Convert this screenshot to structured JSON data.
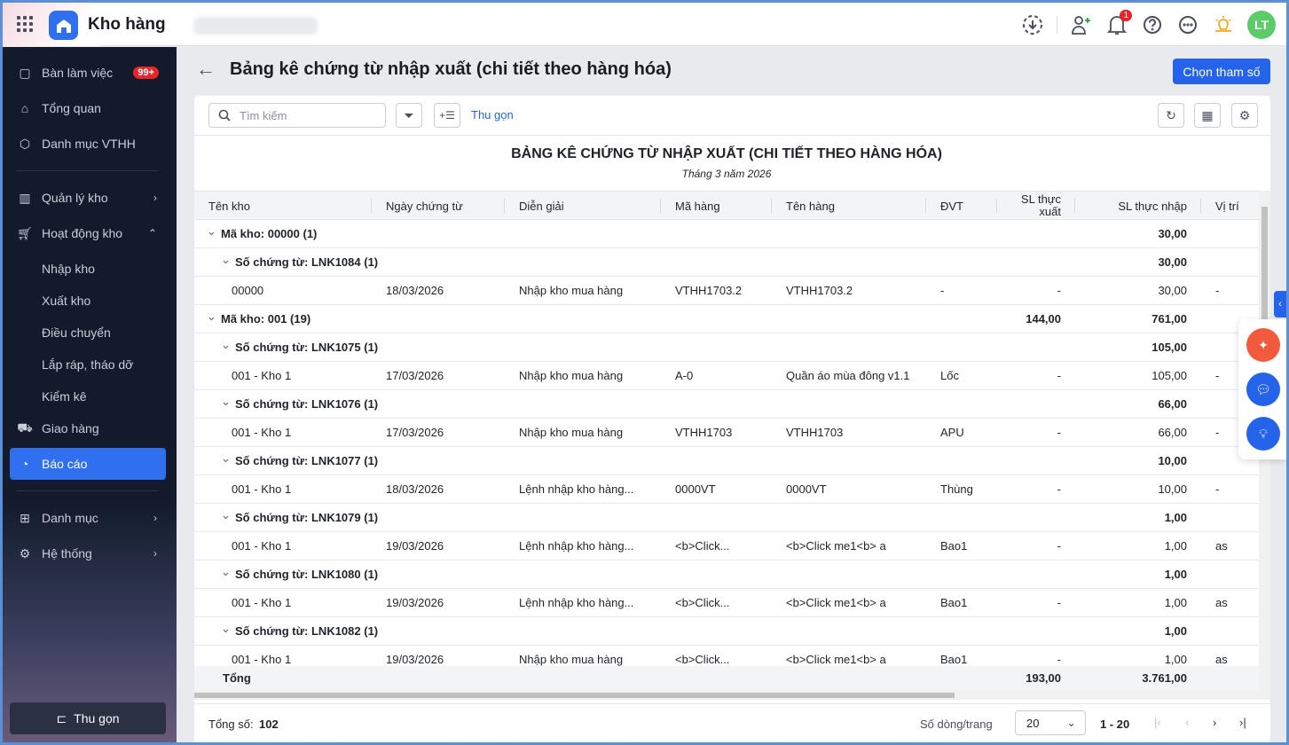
{
  "app": {
    "title": "Kho hàng",
    "notification_count": "1",
    "avatar_initials": "LT"
  },
  "sidebar": {
    "items": [
      {
        "label": "Bàn làm việc",
        "badge": "99+"
      },
      {
        "label": "Tổng quan"
      },
      {
        "label": "Danh mục VTHH"
      },
      {
        "label": "Quản lý kho"
      },
      {
        "label": "Hoạt động kho"
      },
      {
        "label": "Nhập kho"
      },
      {
        "label": "Xuất kho"
      },
      {
        "label": "Điều chuyển"
      },
      {
        "label": "Lắp ráp, tháo dỡ"
      },
      {
        "label": "Kiểm kê"
      },
      {
        "label": "Giao hàng"
      },
      {
        "label": "Báo cáo"
      },
      {
        "label": "Danh mục"
      },
      {
        "label": "Hệ thống"
      }
    ],
    "collapse_label": "Thu gọn"
  },
  "page": {
    "title": "Bảng kê chứng từ nhập xuất (chi tiết theo hàng hóa)",
    "choose_params": "Chọn tham số"
  },
  "toolbar": {
    "search_placeholder": "Tìm kiếm",
    "collapse_link": "Thu gọn"
  },
  "report": {
    "title": "BẢNG KÊ CHỨNG TỪ NHẬP XUẤT (CHI TIẾT THEO HÀNG HÓA)",
    "subtitle": "Tháng 3 năm 2026"
  },
  "table": {
    "columns": [
      "Tên kho",
      "Ngày chứng từ",
      "Diễn giải",
      "Mã hàng",
      "Tên hàng",
      "ĐVT",
      "SL thực xuất",
      "SL thực nhập",
      "Vị trí"
    ],
    "rows": [
      {
        "type": "g1",
        "label": "Mã kho: 00000 (1)",
        "xuat": "",
        "nhap": "30,00"
      },
      {
        "type": "g2",
        "label": "Số chứng từ: LNK1084 (1)",
        "xuat": "",
        "nhap": "30,00"
      },
      {
        "type": "d",
        "cells": [
          "00000",
          "18/03/2026",
          "Nhập kho mua hàng",
          "VTHH1703.2",
          "VTHH1703.2",
          "-",
          "-",
          "30,00",
          "-"
        ]
      },
      {
        "type": "g1",
        "label": "Mã kho: 001 (19)",
        "xuat": "144,00",
        "nhap": "761,00"
      },
      {
        "type": "g2",
        "label": "Số chứng từ: LNK1075 (1)",
        "xuat": "",
        "nhap": "105,00"
      },
      {
        "type": "d",
        "cells": [
          "001 - Kho 1",
          "17/03/2026",
          "Nhập kho mua hàng",
          "A-0",
          "Quần áo mùa đông v1.1",
          "Lốc",
          "-",
          "105,00",
          "-"
        ]
      },
      {
        "type": "g2",
        "label": "Số chứng từ: LNK1076 (1)",
        "xuat": "",
        "nhap": "66,00"
      },
      {
        "type": "d",
        "cells": [
          "001 - Kho 1",
          "17/03/2026",
          "Nhập kho mua hàng",
          "VTHH1703",
          "VTHH1703",
          "APU",
          "-",
          "66,00",
          "-"
        ]
      },
      {
        "type": "g2",
        "label": "Số chứng từ: LNK1077 (1)",
        "xuat": "",
        "nhap": "10,00"
      },
      {
        "type": "d",
        "cells": [
          "001 - Kho 1",
          "18/03/2026",
          "Lệnh nhập kho hàng...",
          "0000VT",
          "0000VT",
          "Thùng",
          "-",
          "10,00",
          "-"
        ]
      },
      {
        "type": "g2",
        "label": "Số chứng từ: LNK1079 (1)",
        "xuat": "",
        "nhap": "1,00"
      },
      {
        "type": "d",
        "cells": [
          "001 - Kho 1",
          "19/03/2026",
          "Lệnh nhập kho hàng...",
          "<b>Click...",
          "<b>Click me1<b> a",
          "Bao1",
          "-",
          "1,00",
          "as"
        ]
      },
      {
        "type": "g2",
        "label": "Số chứng từ: LNK1080 (1)",
        "xuat": "",
        "nhap": "1,00"
      },
      {
        "type": "d",
        "cells": [
          "001 - Kho 1",
          "19/03/2026",
          "Lệnh nhập kho hàng...",
          "<b>Click...",
          "<b>Click me1<b> a",
          "Bao1",
          "-",
          "1,00",
          "as"
        ]
      },
      {
        "type": "g2",
        "label": "Số chứng từ: LNK1082 (1)",
        "xuat": "",
        "nhap": "1,00"
      },
      {
        "type": "d",
        "cells": [
          "001 - Kho 1",
          "19/03/2026",
          "Nhập kho mua hàng",
          "<b>Click...",
          "<b>Click me1<b> a",
          "Bao1",
          "-",
          "1,00",
          "as"
        ]
      }
    ],
    "total": {
      "label": "Tổng",
      "xuat": "193,00",
      "nhap": "3.761,00"
    }
  },
  "footer": {
    "total_label": "Tổng số:",
    "total_value": "102",
    "rows_per_page_label": "Số dòng/trang",
    "rows_per_page": "20",
    "range": "1 - 20"
  }
}
